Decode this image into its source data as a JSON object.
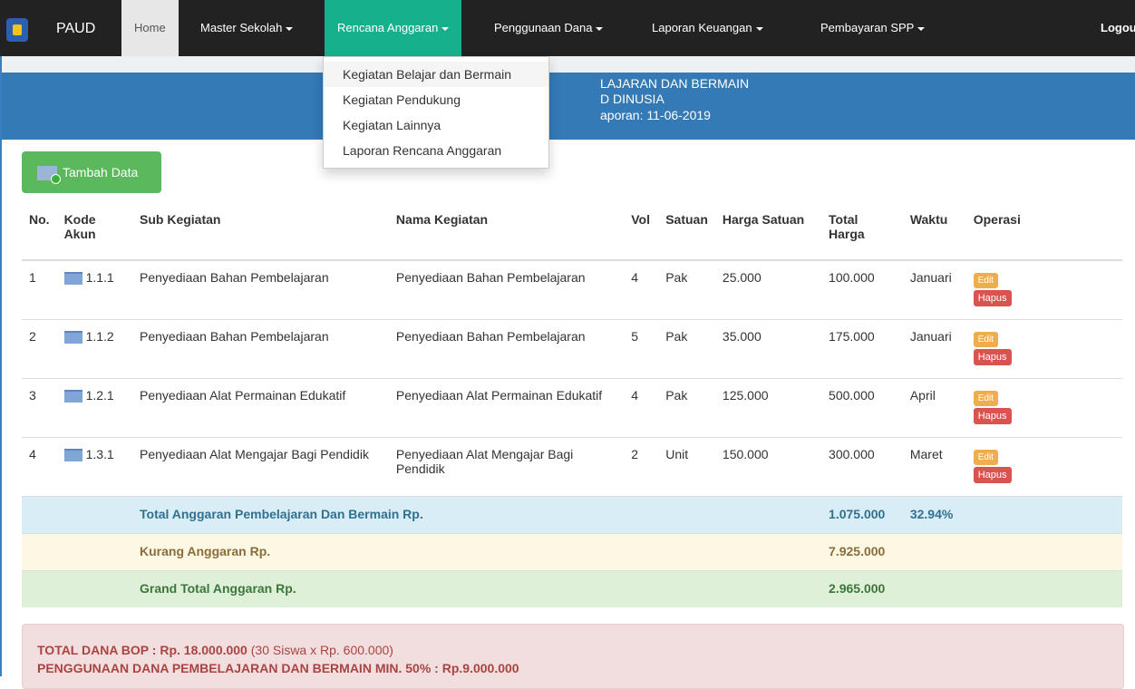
{
  "nav": {
    "brand": "PAUD",
    "home": "Home",
    "master": "Master Sekolah",
    "rencana": "Rencana Anggaran",
    "penggunaan": "Penggunaan Dana",
    "laporan": "Laporan Keuangan",
    "pembayaran": "Pembayaran SPP",
    "logout": "Logou"
  },
  "dropdown": [
    "Kegiatan Belajar dan Bermain",
    "Kegiatan Pendukung",
    "Kegiatan Lainnya",
    "Laporan Rencana Anggaran"
  ],
  "banner": {
    "line1": "LAJARAN DAN BERMAIN",
    "line2": "D DINUSIA",
    "line3": "aporan: 11-06-2019"
  },
  "add_button": "Tambah Data",
  "table": {
    "headers": {
      "no": "No.",
      "kode": "Kode Akun",
      "sub": "Sub Kegiatan",
      "nama": "Nama Kegiatan",
      "vol": "Vol",
      "satuan": "Satuan",
      "harga": "Harga Satuan",
      "total": "Total Harga",
      "waktu": "Waktu",
      "operasi": "Operasi"
    },
    "rows": [
      {
        "no": "1",
        "kode": "1.1.1",
        "sub": "Penyediaan Bahan Pembelajaran",
        "nama": "Penyediaan Bahan Pembelajaran",
        "vol": "4",
        "satuan": "Pak",
        "harga": "25.000",
        "total": "100.000",
        "waktu": "Januari"
      },
      {
        "no": "2",
        "kode": "1.1.2",
        "sub": "Penyediaan Bahan Pembelajaran",
        "nama": "Penyediaan Bahan Pembelajaran",
        "vol": "5",
        "satuan": "Pak",
        "harga": "35.000",
        "total": "175.000",
        "waktu": "Januari"
      },
      {
        "no": "3",
        "kode": "1.2.1",
        "sub": "Penyediaan Alat Permainan Edukatif",
        "nama": "Penyediaan Alat Permainan Edukatif",
        "vol": "4",
        "satuan": "Pak",
        "harga": "125.000",
        "total": "500.000",
        "waktu": "April"
      },
      {
        "no": "4",
        "kode": "1.3.1",
        "sub": "Penyediaan Alat Mengajar Bagi Pendidik",
        "nama": "Penyediaan Alat Mengajar Bagi Pendidik",
        "vol": "2",
        "satuan": "Unit",
        "harga": "150.000",
        "total": "300.000",
        "waktu": "Maret"
      }
    ],
    "edit_label": "Edit",
    "hapus_label": "Hapus",
    "summary": {
      "total_label": "Total Anggaran Pembelajaran Dan Bermain Rp.",
      "total_value": "1.075.000",
      "total_pct": "32.94%",
      "kurang_label": "Kurang Anggaran Rp.",
      "kurang_value": "7.925.000",
      "grand_label": "Grand Total Anggaran Rp.",
      "grand_value": "2.965.000"
    }
  },
  "alert": {
    "line1_bold": "TOTAL DANA BOP : Rp. 18.000.000",
    "line1_rest": " (30 Siswa x Rp. 600.000)",
    "line2": "PENGGUNAAN DANA PEMBELAJARAN DAN BERMAIN MIN. 50% : Rp.9.000.000"
  }
}
